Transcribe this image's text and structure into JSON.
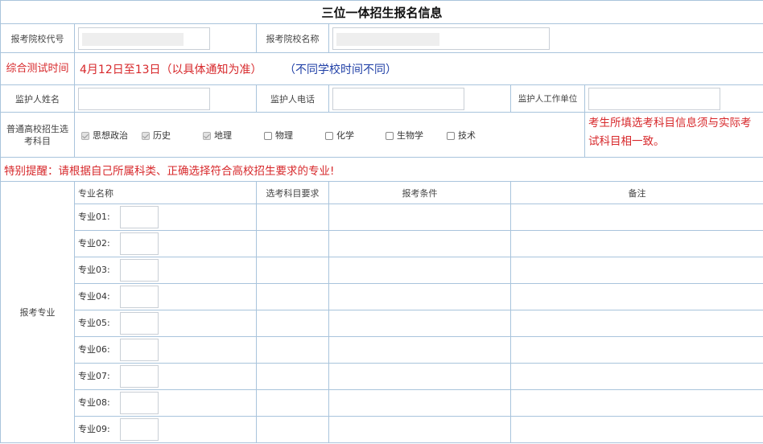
{
  "title": "三位一体招生报名信息",
  "school": {
    "code_label": "报考院校代号",
    "name_label": "报考院校名称"
  },
  "test": {
    "label": "综合测试时间",
    "date": "4月12日至13日（以具体通知为准）",
    "note": "（不同学校时间不同）"
  },
  "guardian": {
    "name_label": "监护人姓名",
    "phone_label": "监护人电话",
    "work_label": "监护人工作单位"
  },
  "subjects": {
    "label": "普通高校招生选考科目",
    "items": [
      {
        "label": "思想政治",
        "checked": true
      },
      {
        "label": "历史",
        "checked": true
      },
      {
        "label": "地理",
        "checked": true
      },
      {
        "label": "物理",
        "checked": false
      },
      {
        "label": "化学",
        "checked": false
      },
      {
        "label": "生物学",
        "checked": false
      },
      {
        "label": "技术",
        "checked": false
      }
    ],
    "note": "考生所填选考科目信息须与实际考试科目相一致。"
  },
  "reminder": "特别提醒：请根据自己所属科类、正确选择符合高校招生要求的专业!",
  "majors": {
    "section_label": "报考专业",
    "headers": {
      "name": "专业名称",
      "req": "选考科目要求",
      "cond": "报考条件",
      "note": "备注"
    },
    "rows": [
      "专业01:",
      "专业02:",
      "专业03:",
      "专业04:",
      "专业05:",
      "专业06:",
      "专业07:",
      "专业08:",
      "专业09:"
    ]
  },
  "colors": {
    "border": "#a9c4dc",
    "alert_red": "#d7282b",
    "note_blue": "#1f3fa6"
  }
}
